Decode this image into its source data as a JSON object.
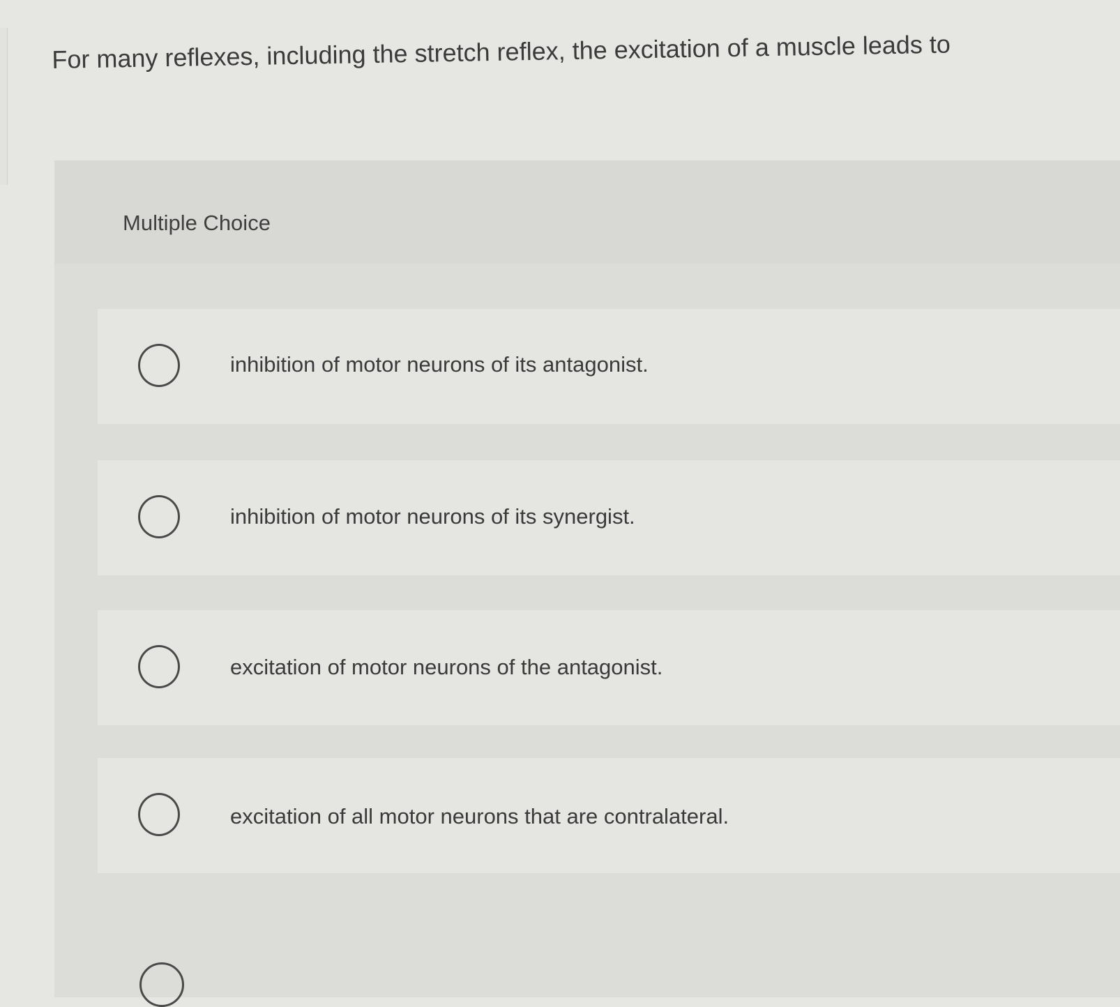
{
  "question": {
    "text": "For many reflexes, including the stretch reflex, the excitation of a muscle leads to"
  },
  "panel": {
    "type_label": "Multiple Choice"
  },
  "choices": [
    {
      "text": "inhibition of motor neurons of its antagonist."
    },
    {
      "text": "inhibition of motor neurons of its synergist."
    },
    {
      "text": "excitation of motor neurons of the antagonist."
    },
    {
      "text": "excitation of all motor neurons that are contralateral."
    }
  ]
}
